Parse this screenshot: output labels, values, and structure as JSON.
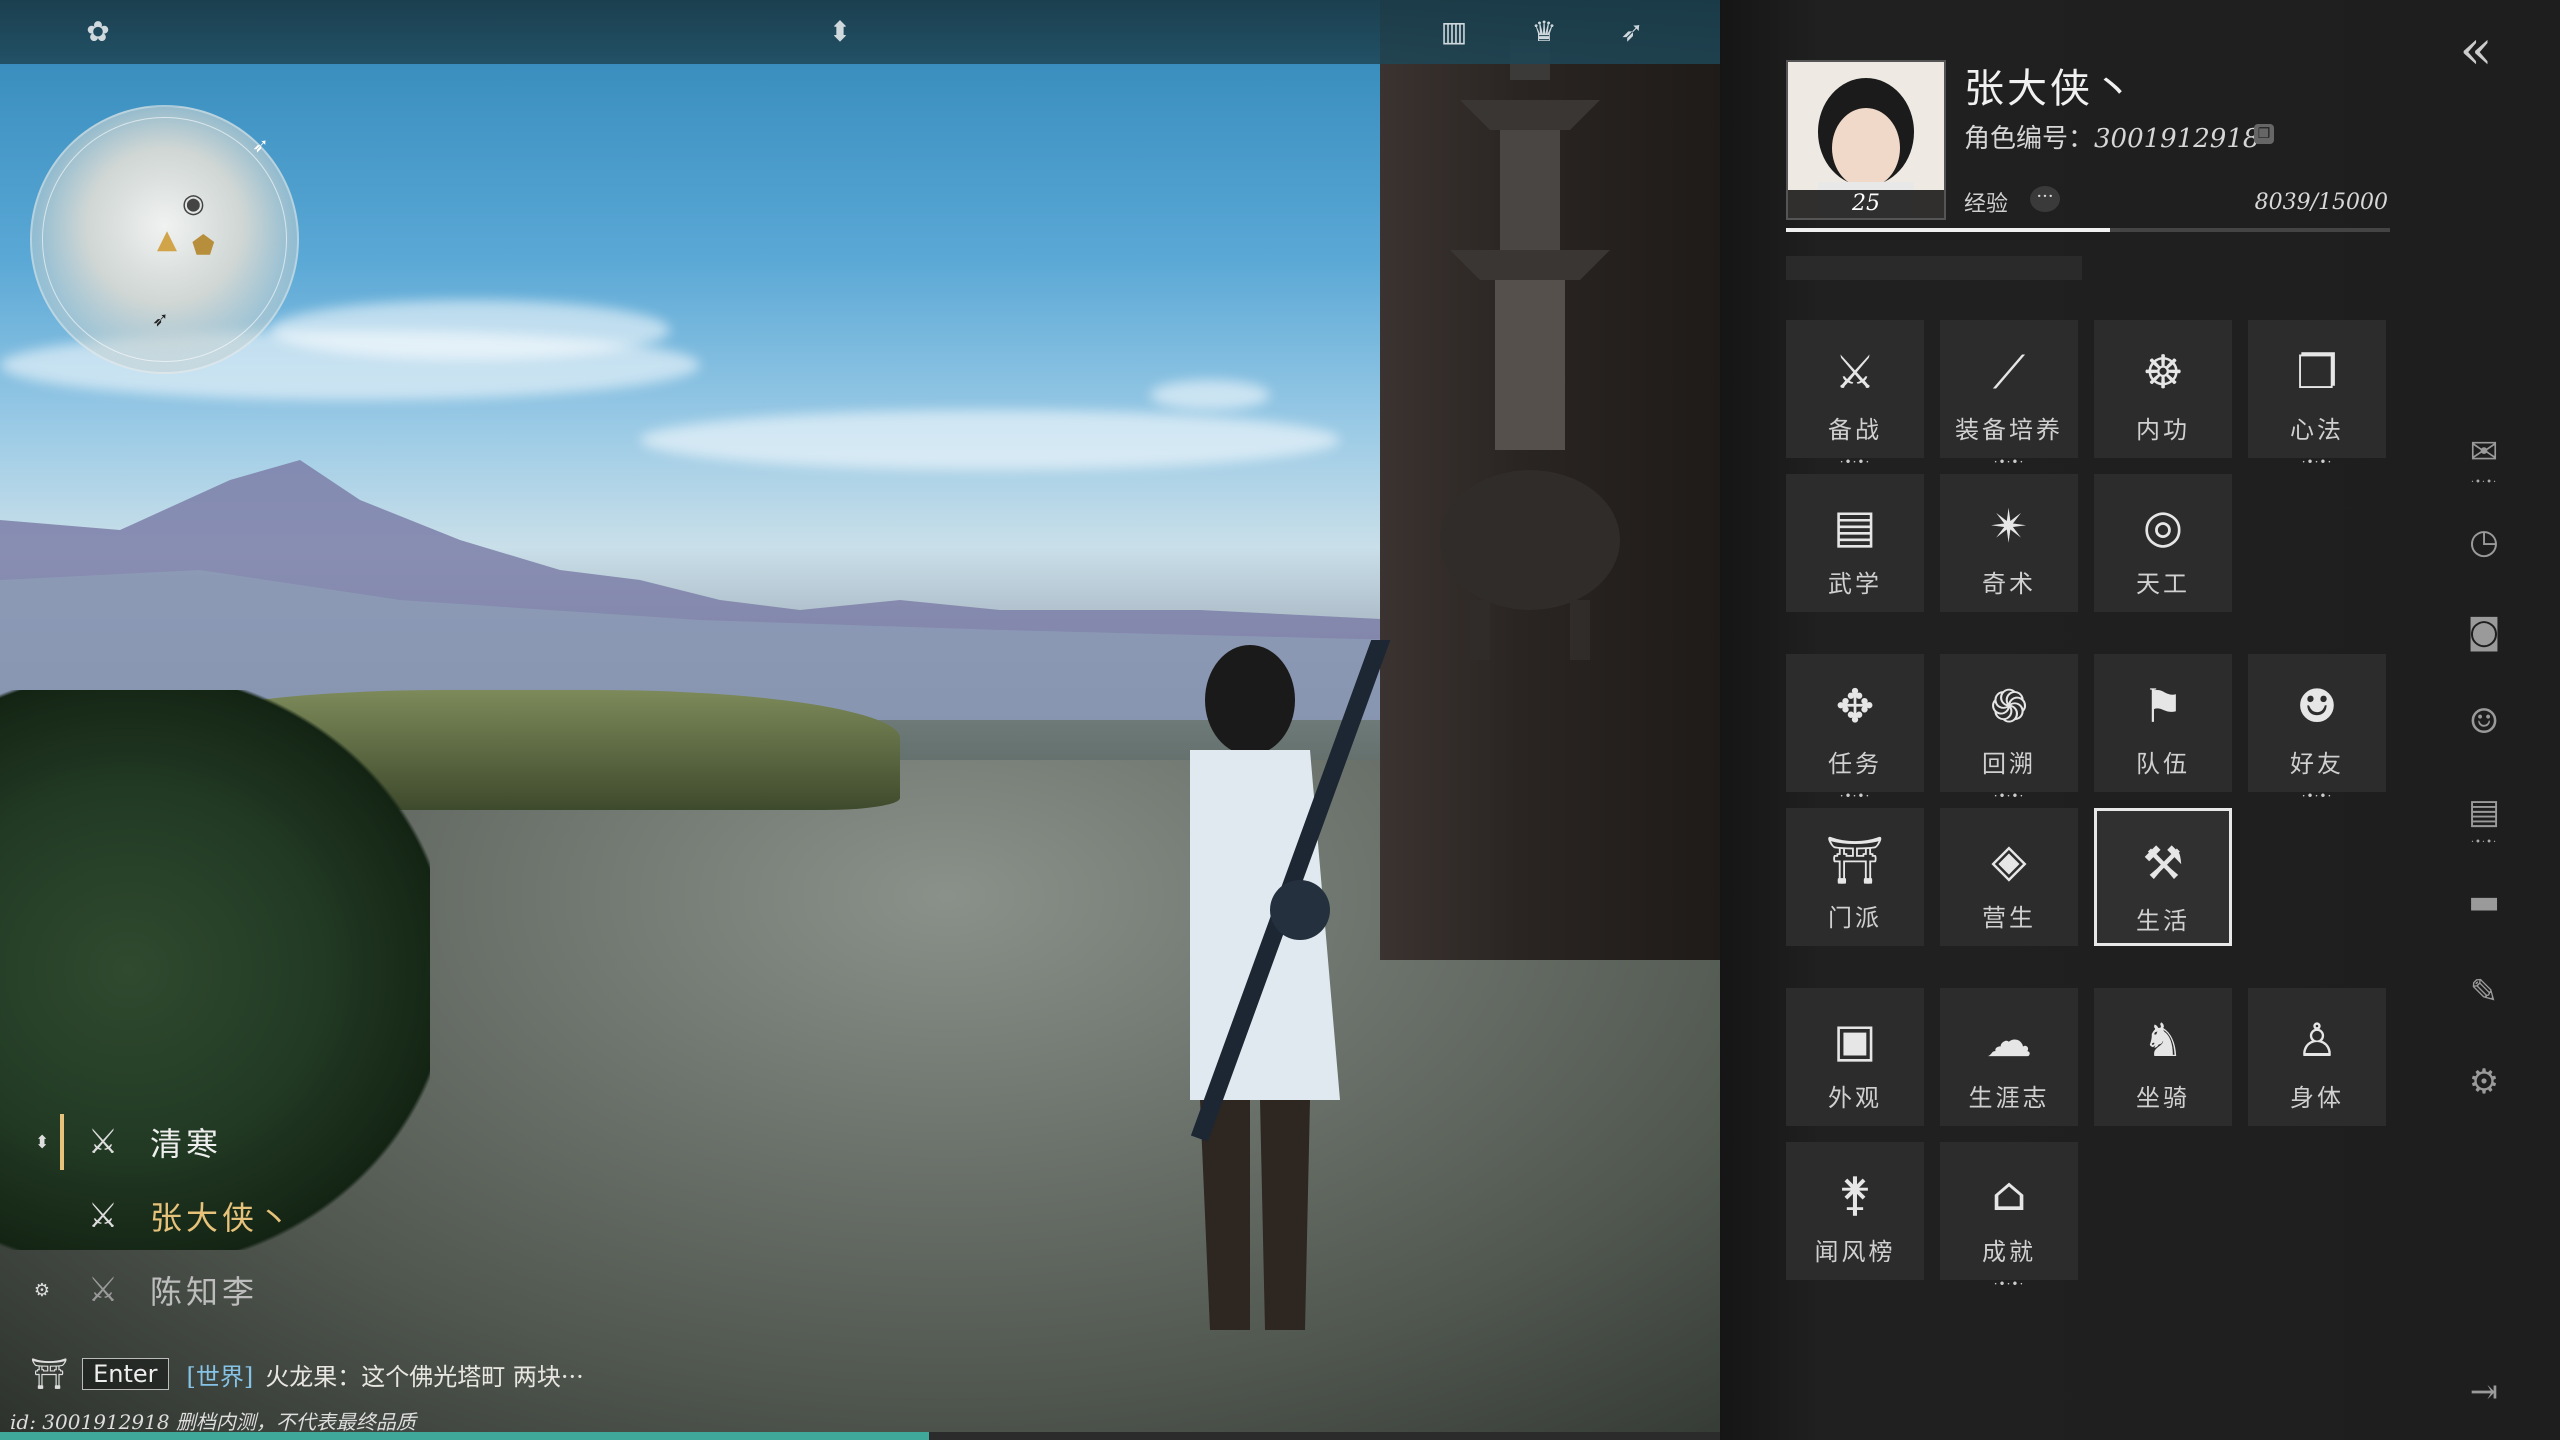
{
  "colors": {
    "accent_teal": "#3fa89a",
    "chat_channel": "#86c3e6",
    "party_self_name": "#e6c27a",
    "party_active_bar": "#e6c27a",
    "panel_bg": "#1e1e1e",
    "tile_bg": "#2c2c2c"
  },
  "topbar": {
    "icons": [
      "lotus-icon",
      "diamond-arrows-icon",
      "book-icon",
      "crown-icon",
      "swallow-icon"
    ]
  },
  "minimap": {
    "icons": [
      "player-marker-icon",
      "npc-marker-icon",
      "waypoint-icon",
      "bird-icon"
    ]
  },
  "party": [
    {
      "name": "清寒",
      "side_icon": "up-down-arrows-icon",
      "active": true
    },
    {
      "name": "张大侠丶",
      "side_icon": "",
      "active": false,
      "is_self": true
    },
    {
      "name": "陈知李",
      "side_icon": "gear-icon",
      "active": false
    }
  ],
  "chat": {
    "enter_label": "Enter",
    "channel": "[世界]",
    "message": "火龙果：这个佛光塔町 两块···"
  },
  "footer": {
    "id_line": "id: 3001912918  删档内测，不代表最终品质"
  },
  "progress": {
    "bottom_fill": 0.54
  },
  "profile": {
    "name": "张大侠丶",
    "id_label": "角色编号：",
    "id_value": "3001912918",
    "level": "25",
    "exp_label": "经验",
    "exp_more": "···",
    "exp_text": "8039/15000",
    "exp_current": 8039,
    "exp_max": 15000
  },
  "tiles": [
    {
      "label": "备战",
      "icon": "sword-icon",
      "dots": true
    },
    {
      "label": "装备培养",
      "icon": "blades-icon",
      "dots": true
    },
    {
      "label": "内功",
      "icon": "meditation-icon",
      "dots": false
    },
    {
      "label": "心法",
      "icon": "open-book-icon",
      "dots": true
    },
    {
      "label": "武学",
      "icon": "manual-icon",
      "dots": false
    },
    {
      "label": "奇术",
      "icon": "burst-icon",
      "dots": false
    },
    {
      "label": "天工",
      "icon": "compass-icon",
      "dots": false
    },
    {
      "label": "任务",
      "icon": "quest-icon",
      "dots": true
    },
    {
      "label": "回溯",
      "icon": "spiral-icon",
      "dots": true
    },
    {
      "label": "队伍",
      "icon": "banner-icon",
      "dots": false
    },
    {
      "label": "好友",
      "icon": "friends-icon",
      "dots": true
    },
    {
      "label": "门派",
      "icon": "gate-icon",
      "dots": false
    },
    {
      "label": "营生",
      "icon": "money-bag-icon",
      "dots": false
    },
    {
      "label": "生活",
      "icon": "hammer-icon",
      "dots": false,
      "selected": true
    },
    {
      "label": "外观",
      "icon": "portrait-icon",
      "dots": false
    },
    {
      "label": "生涯志",
      "icon": "cloud-swirl-icon",
      "dots": false
    },
    {
      "label": "坐骑",
      "icon": "horse-icon",
      "dots": false
    },
    {
      "label": "身体",
      "icon": "body-icon",
      "dots": false
    },
    {
      "label": "闻风榜",
      "icon": "crane-icon",
      "dots": false
    },
    {
      "label": "成就",
      "icon": "arch-icon",
      "dots": true
    }
  ],
  "sidebar": [
    {
      "icon": "mail-icon",
      "dots": true
    },
    {
      "icon": "clock-icon",
      "dots": false
    },
    {
      "icon": "camera-icon",
      "dots": false
    },
    {
      "icon": "smiley-icon",
      "dots": false
    },
    {
      "icon": "notes-icon",
      "dots": true
    },
    {
      "icon": "card-icon",
      "dots": false
    },
    {
      "icon": "brush-icon",
      "dots": false
    },
    {
      "icon": "settings-icon",
      "dots": false
    },
    {
      "icon": "exit-icon",
      "dots": false
    }
  ],
  "collapse_icon": "double-chevron-left-icon"
}
